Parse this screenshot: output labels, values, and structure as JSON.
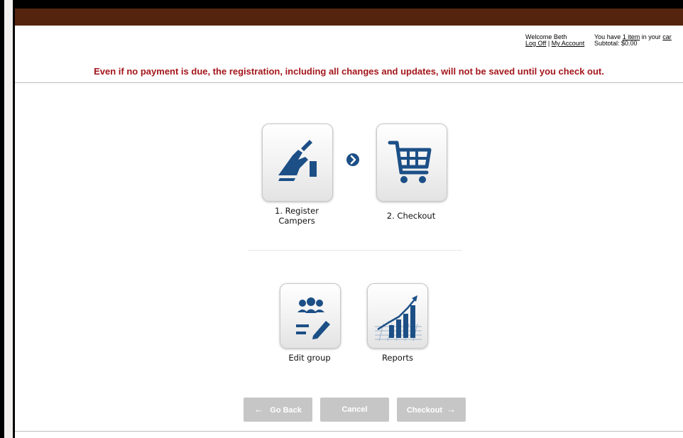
{
  "header": {
    "welcome_text": "Welcome Beth",
    "log_off": "Log Off",
    "separator": "|",
    "my_account": "My Account",
    "cart_prefix": "You have",
    "cart_item_link": "1 item",
    "cart_suffix": "in your",
    "cart_link": "car",
    "subtotal": "Subtotal: $0.00"
  },
  "warning": "Even if no payment is due, the registration, including all changes and updates, will not be saved until you check out.",
  "steps": [
    {
      "label_line1": "1. Register",
      "label_line2": "Campers",
      "icon": "write-hand-icon"
    },
    {
      "label": "2. Checkout",
      "icon": "shopping-cart-icon"
    }
  ],
  "actions": [
    {
      "label": "Edit group",
      "icon": "group-edit-icon"
    },
    {
      "label": "Reports",
      "icon": "bar-chart-growth-icon"
    }
  ],
  "buttons": {
    "go_back": "Go Back",
    "go_back_glyph": "←",
    "cancel": "Cancel",
    "checkout": "Checkout",
    "checkout_glyph": "→"
  },
  "colors": {
    "top_bar": "#55240f",
    "warning_text": "#a3161b",
    "icon_blue": "#1c4f86",
    "button_bg": "#c6c6c6"
  }
}
